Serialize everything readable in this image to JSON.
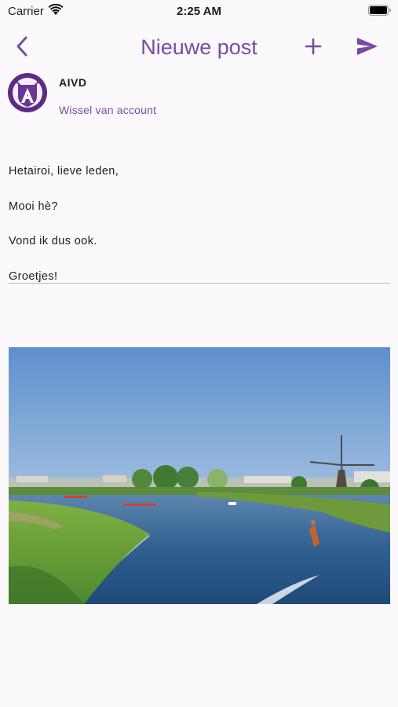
{
  "status_bar": {
    "carrier": "Carrier",
    "time": "2:25 AM"
  },
  "app_bar": {
    "title": "Nieuwe post",
    "icons": {
      "back": "chevron-left-icon",
      "add": "plus-icon",
      "send": "send-icon"
    }
  },
  "account": {
    "name": "AIVD",
    "switch_label": "Wissel van account",
    "avatar_letter": "A"
  },
  "post": {
    "lines": [
      "Hetairoi, lieve leden,",
      "Mooi hè?",
      "Vond ik dus ook.",
      "Groetjes!"
    ]
  },
  "colors": {
    "accent": "#7a4aa2",
    "background": "#fcf9fd",
    "divider": "#b9b6bd"
  }
}
